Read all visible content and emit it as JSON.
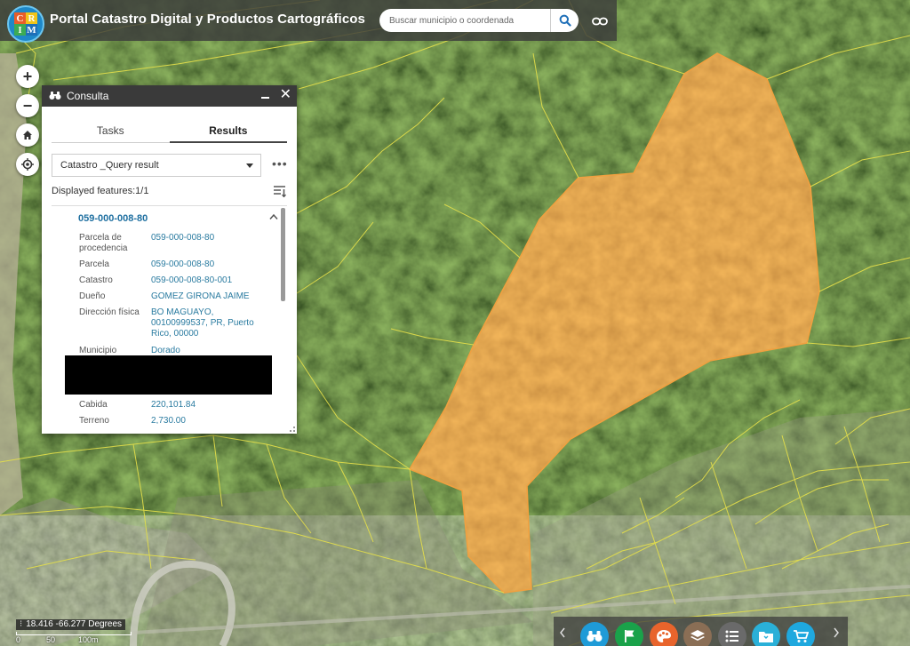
{
  "header": {
    "app_title": "Portal Catastro Digital y Productos Cartográficos",
    "logo_letters": [
      "C",
      "R",
      "I",
      "M"
    ],
    "search_placeholder": "Buscar municipio o coordenada"
  },
  "map_controls": {
    "zoom_in": "+",
    "zoom_out": "−"
  },
  "panel": {
    "title": "Consulta",
    "tabs": [
      {
        "label": "Tasks",
        "active": false
      },
      {
        "label": "Results",
        "active": true
      }
    ],
    "layer_select": "Catastro _Query result",
    "more_label": "•••",
    "displayed_features": "Displayed features:1/1",
    "feature": {
      "title": "059-000-008-80",
      "attributes": [
        {
          "label": "Parcela de procedencia",
          "value": "059-000-008-80"
        },
        {
          "label": "Parcela",
          "value": "059-000-008-80"
        },
        {
          "label": "Catastro",
          "value": "059-000-008-80-001"
        },
        {
          "label": "Dueño",
          "value": "GOMEZ GIRONA JAIME"
        },
        {
          "label": "Dirección física",
          "value": "BO MAGUAYO, 00100999537, PR, Puerto Rico, 00000"
        },
        {
          "label": "Municipio",
          "value": "Dorado"
        },
        {
          "label": "Cabida",
          "value": "220,101.84"
        },
        {
          "label": "Terreno",
          "value": "2,730.00"
        }
      ]
    }
  },
  "status": {
    "coordinates": "18.416 -66.277 Degrees",
    "scale_labels": [
      "0",
      "50",
      "100m"
    ]
  },
  "toolbar": {
    "buttons": [
      {
        "name": "query",
        "icon": "binoculars-icon",
        "color": "#1f9bd7"
      },
      {
        "name": "bookmark",
        "icon": "flag-icon",
        "color": "#1aa24a"
      },
      {
        "name": "basemap",
        "icon": "palette-icon",
        "color": "#e8642c"
      },
      {
        "name": "layers",
        "icon": "layers-icon",
        "color": "#8a6e55"
      },
      {
        "name": "legend",
        "icon": "list-icon",
        "color": "#6a6a6a"
      },
      {
        "name": "files",
        "icon": "folder-icon",
        "color": "#2ab0d8"
      },
      {
        "name": "cart",
        "icon": "cart-icon",
        "color": "#1fa8de"
      }
    ]
  },
  "colors": {
    "parcel_fill": "#d9822b",
    "parcel_stroke": "#f0a040",
    "parcel_lines": "#e6e04a",
    "value_text": "#2a7ba0"
  }
}
